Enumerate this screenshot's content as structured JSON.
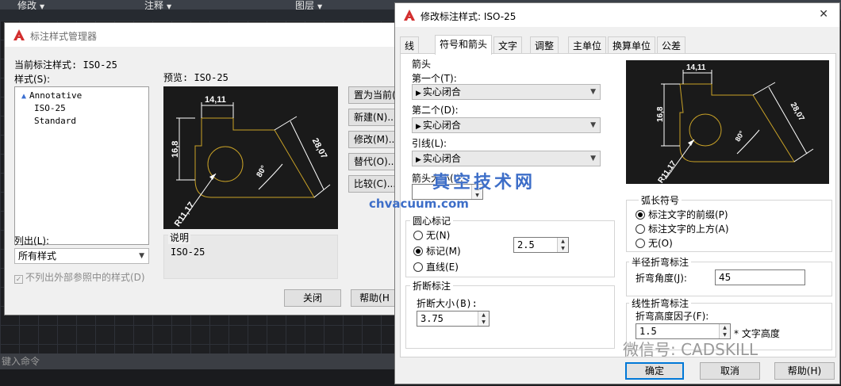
{
  "ribbon": {
    "panels": [
      "修改",
      "注释",
      "图层"
    ]
  },
  "command_line": {
    "placeholder": "键入命令"
  },
  "dim_manager": {
    "title": "标注样式管理器",
    "current_style_label": "当前标注样式: ISO-25",
    "styles_label": "样式(S):",
    "styles": [
      "Annotative",
      "ISO-25",
      "Standard"
    ],
    "preview_label": "预览: ISO-25",
    "buttons": [
      "置为当前(",
      "新建(N)...",
      "修改(M)...",
      "替代(O)...",
      "比较(C)..."
    ],
    "list_label": "列出(L):",
    "list_value": "所有样式",
    "exclude_xref": "不列出外部参照中的样式(D)",
    "description_label": "说明",
    "description_value": "ISO-25",
    "close_button": "关闭",
    "help_button": "帮助(H"
  },
  "preview_drawing": {
    "dim_top": "14,11",
    "dim_left": "16,8",
    "dim_diag": "28,07",
    "dim_angle": "80°",
    "dim_radius": "R11,17"
  },
  "modify_dialog": {
    "title": "修改标注样式: ISO-25",
    "close_glyph": "✕",
    "tabs": [
      "线",
      "符号和箭头",
      "文字",
      "调整",
      "主单位",
      "换算单位",
      "公差"
    ],
    "active_tab": "符号和箭头",
    "arrows": {
      "group": "箭头",
      "first_label": "第一个(T):",
      "first_value": "实心闭合",
      "second_label": "第二个(D):",
      "second_value": "实心闭合",
      "leader_label": "引线(L):",
      "leader_value": "实心闭合",
      "size_label": "箭头大小(I):"
    },
    "center_marks": {
      "group": "圆心标记",
      "none": "无(N)",
      "mark": "标记(M)",
      "line": "直线(E)",
      "selected": "mark",
      "size_value": "2.5"
    },
    "break": {
      "group": "折断标注",
      "size_label": "折断大小(B):",
      "size_value": "3.75"
    },
    "arc_length": {
      "group": "弧长符号",
      "prefix": "标注文字的前缀(P)",
      "above": "标注文字的上方(A)",
      "none": "无(O)",
      "selected": "prefix"
    },
    "radius_jog": {
      "group": "半径折弯标注",
      "angle_label": "折弯角度(J):",
      "angle_value": "45"
    },
    "linear_jog": {
      "group": "线性折弯标注",
      "factor_label": "折弯高度因子(F):",
      "factor_value": "1.5",
      "suffix": "* 文字高度"
    },
    "ok_button": "确定",
    "cancel_button": "取消",
    "help_button": "帮助(H)"
  },
  "watermark": {
    "text": "真空技术网",
    "url": "chvacuum.com"
  },
  "wechat_label": "微信号: CADSKILL",
  "colors": {
    "preview_line": "#c9a227",
    "preview_text": "#ffffff",
    "accent": "#0078d7",
    "app_red": "#d32f2f"
  }
}
